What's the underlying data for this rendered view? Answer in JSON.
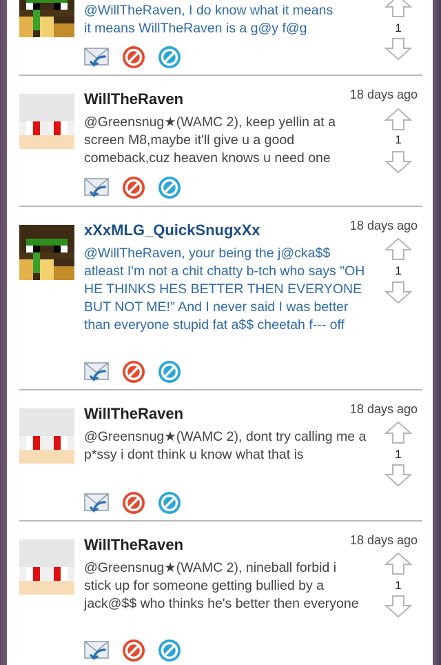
{
  "comments": [
    {
      "username": "",
      "time": "",
      "text": "@WillTheRaven, I do know what it means\nit means WillTheRaven is a g@y f@g",
      "votes": "1",
      "avatar": "creeper-skin-avatar",
      "text_color": "#2f6aa8"
    },
    {
      "username": "WillTheRaven",
      "time": "18 days ago",
      "text": "@Greensnug★(WAMC 2), keep yellin at a screen M8,maybe it'll give u a good comeback,cuz heaven knows u need one",
      "votes": "1",
      "avatar": "white-skin-avatar",
      "text_color": "#444444"
    },
    {
      "username": "xXxMLG_QuickSnugxXx",
      "time": "18 days ago",
      "text": "@WillTheRaven, your being the j@cka$$ atleast I'm not a chit chatty b-tch who says \"OH HE THINKS HES BETTER THEN EVERYONE BUT NOT ME!\" And I never said I was better than everyone stupid fat a$$ cheetah f--- off",
      "votes": "1",
      "avatar": "creeper-skin-avatar",
      "text_color": "#2f6aa8"
    },
    {
      "username": "WillTheRaven",
      "time": "18 days ago",
      "text": "@Greensnug★(WAMC 2), dont try calling me a p*ssy i dont think u know what that is",
      "votes": "1",
      "avatar": "white-skin-avatar",
      "text_color": "#444444"
    },
    {
      "username": "WillTheRaven",
      "time": "18 days ago",
      "text": "@Greensnug★(WAMC 2), nineball forbid i stick up for someone getting bullied by a jack@$$ who thinks he's better then everyone",
      "votes": "1",
      "avatar": "white-skin-avatar",
      "text_color": "#444444"
    }
  ],
  "icons": {
    "reply": "reply-icon",
    "flag": "flag-icon",
    "block": "block-icon",
    "upvote": "upvote-arrow-icon",
    "downvote": "downvote-arrow-icon"
  },
  "colors": {
    "flag_red": "#e54a2f",
    "block_blue": "#2aa7d8",
    "username_blue": "#1c4f8a"
  }
}
